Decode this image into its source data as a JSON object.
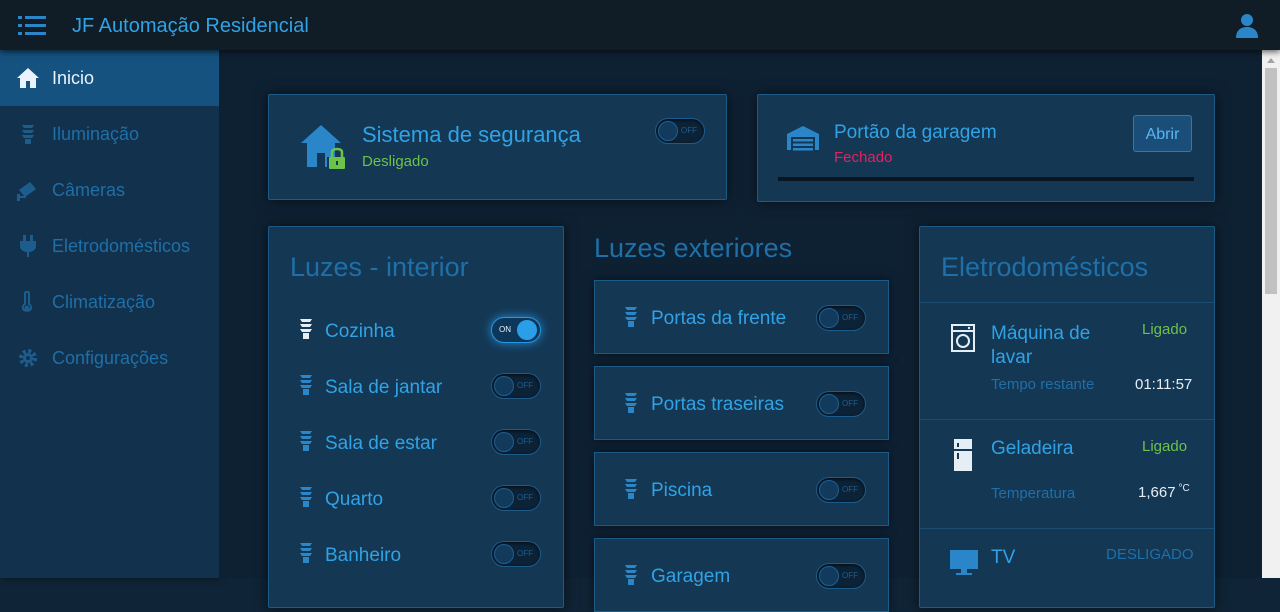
{
  "app": {
    "title": "JF Automação Residencial"
  },
  "sidebar": {
    "items": [
      {
        "label": "Inicio",
        "icon": "home-icon",
        "active": true
      },
      {
        "label": "Iluminação",
        "icon": "bulb-icon"
      },
      {
        "label": "Câmeras",
        "icon": "camera-icon"
      },
      {
        "label": "Eletrodomésticos",
        "icon": "plug-icon"
      },
      {
        "label": "Climatização",
        "icon": "thermometer-icon"
      },
      {
        "label": "Configurações",
        "icon": "gear-icon"
      }
    ]
  },
  "security": {
    "title": "Sistema de segurança",
    "status": "Desligado",
    "toggle": "OFF"
  },
  "garage": {
    "title": "Portão da garagem",
    "status": "Fechado",
    "button": "Abrir",
    "progress_percent": 0
  },
  "lights_interior": {
    "title": "Luzes - interior",
    "items": [
      {
        "label": "Cozinha",
        "toggle": "ON"
      },
      {
        "label": "Sala de jantar",
        "toggle": "OFF"
      },
      {
        "label": "Sala de estar",
        "toggle": "OFF"
      },
      {
        "label": "Quarto",
        "toggle": "OFF"
      },
      {
        "label": "Banheiro",
        "toggle": "OFF"
      }
    ]
  },
  "lights_exterior": {
    "title": "Luzes exteriores",
    "items": [
      {
        "label": "Portas da frente",
        "toggle": "OFF"
      },
      {
        "label": "Portas traseiras",
        "toggle": "OFF"
      },
      {
        "label": "Piscina",
        "toggle": "OFF"
      },
      {
        "label": "Garagem",
        "toggle": "OFF"
      }
    ]
  },
  "appliances": {
    "title": "Eletrodomésticos",
    "items": [
      {
        "name": "Máquina de lavar",
        "status": "Ligado",
        "detail_label": "Tempo restante",
        "detail_value": "01:11:57"
      },
      {
        "name": "Geladeira",
        "status": "Ligado",
        "detail_label": "Temperatura",
        "detail_value": "1,667",
        "detail_unit": "°C"
      },
      {
        "name": "TV",
        "status": "DESLIGADO"
      }
    ]
  },
  "colors": {
    "accent": "#2fa3e6",
    "on": "#6cc24a",
    "alert": "#e8205e",
    "background": "#0e2133"
  }
}
